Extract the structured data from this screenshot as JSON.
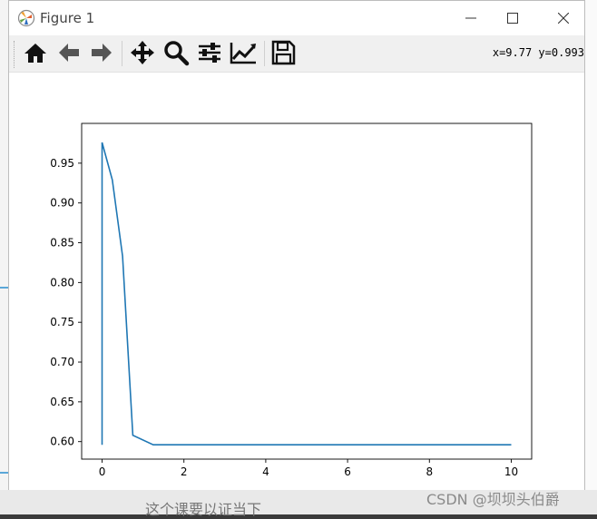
{
  "window": {
    "title": "Figure 1",
    "controls": {
      "minimize": "minimize",
      "maximize": "maximize",
      "close": "close"
    }
  },
  "toolbar": {
    "buttons": [
      {
        "name": "home",
        "icon": "home-icon"
      },
      {
        "name": "back",
        "icon": "arrow-left-icon"
      },
      {
        "name": "forward",
        "icon": "arrow-right-icon"
      },
      {
        "name": "pan",
        "icon": "move-icon"
      },
      {
        "name": "zoom",
        "icon": "magnifier-icon"
      },
      {
        "name": "configure-subplots",
        "icon": "sliders-icon"
      },
      {
        "name": "edit-axes",
        "icon": "line-chart-icon"
      },
      {
        "name": "save",
        "icon": "floppy-disk-icon"
      }
    ],
    "coords": "x=9.77 y=0.993"
  },
  "background": {
    "bottom_text": "这个课要以证当下",
    "watermark": "CSDN @坝坝头伯爵"
  },
  "chart_data": {
    "type": "line",
    "title": "",
    "xlabel": "",
    "ylabel": "",
    "xlim": [
      -0.5,
      10.5
    ],
    "ylim": [
      0.578,
      1.0
    ],
    "xticks": [
      "0",
      "2",
      "4",
      "6",
      "8",
      "10"
    ],
    "yticks": [
      "0.60",
      "0.65",
      "0.70",
      "0.75",
      "0.80",
      "0.85",
      "0.90",
      "0.95"
    ],
    "grid": false,
    "line_color": "#1f77b4",
    "series": [
      {
        "x": [
          0.0,
          0.0,
          0.0,
          0.25,
          0.5,
          0.75,
          1.25,
          2.5,
          5.0,
          10.0
        ],
        "y": [
          0.947,
          0.596,
          0.976,
          0.929,
          0.833,
          0.608,
          0.596,
          0.596,
          0.596,
          0.596
        ]
      }
    ]
  }
}
